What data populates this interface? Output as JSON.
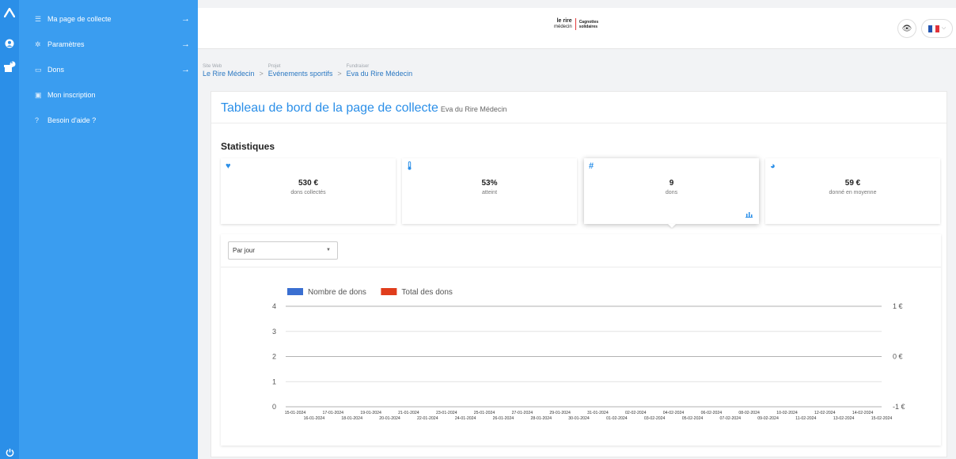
{
  "colors": {
    "accent": "#2b8fe8",
    "menu_bg": "#3a9df0",
    "series_count": "#3a6fd1",
    "series_total": "#e03d1c"
  },
  "rail": {
    "icons": [
      "logo-icon",
      "user-icon",
      "gift-icon",
      "power-icon"
    ],
    "badge": "1"
  },
  "menu": {
    "items": [
      {
        "label": "Ma page de collecte",
        "icon": "list-icon",
        "arrow": "→"
      },
      {
        "label": "Paramètres",
        "icon": "gear-icon",
        "arrow": "→"
      },
      {
        "label": "Dons",
        "icon": "card-icon",
        "arrow": "→"
      },
      {
        "label": "Mon inscription",
        "icon": "ticket-icon",
        "arrow": ""
      },
      {
        "label": "Besoin d'aide ?",
        "icon": "help-icon",
        "arrow": ""
      }
    ]
  },
  "header": {
    "logo_line1": "le rire",
    "logo_line2": "médecin",
    "logo_line3": "Cagnottes",
    "logo_line4": "solidaires"
  },
  "breadcrumb": [
    {
      "small": "Site Web",
      "big": "Le Rire Médecin"
    },
    {
      "small": "Projet",
      "big": "Evénements sportifs"
    },
    {
      "small": "Fundraiser",
      "big": "Eva du Rire Médecin"
    }
  ],
  "breadcrumb_sep": ">",
  "page": {
    "title": "Tableau de bord de la page de collecte",
    "subtitle": "Eva du Rire Médecin",
    "stats_heading": "Statistiques"
  },
  "stats": [
    {
      "value": "530 €",
      "label": "dons collectés",
      "icon": "heart-icon",
      "glyph": "♥"
    },
    {
      "value": "53%",
      "label": "atteint",
      "icon": "thermometer-icon",
      "glyph": "🌡"
    },
    {
      "value": "9",
      "label": "dons",
      "icon": "hash-icon",
      "glyph": "#"
    },
    {
      "value": "59 €",
      "label": "donné en moyenne",
      "icon": "gauge-icon",
      "glyph": "◕"
    }
  ],
  "filter": {
    "selected": "Par jour"
  },
  "chart_data": {
    "type": "line",
    "series": [
      {
        "name": "Nombre de dons",
        "values": []
      },
      {
        "name": "Total des dons",
        "values": []
      }
    ],
    "ylim_left": [
      0,
      4
    ],
    "yticks_left": [
      "0",
      "1",
      "2",
      "3",
      "4"
    ],
    "yticks_right": [
      "-1 €",
      "0 €",
      "1 €"
    ],
    "x": [
      "15-01-2024",
      "16-01-2024",
      "17-01-2024",
      "18-01-2024",
      "19-01-2024",
      "20-01-2024",
      "21-01-2024",
      "22-01-2024",
      "23-01-2024",
      "24-01-2024",
      "25-01-2024",
      "26-01-2024",
      "27-01-2024",
      "28-01-2024",
      "29-01-2024",
      "30-01-2024",
      "31-01-2024",
      "01-02-2024",
      "02-02-2024",
      "03-02-2024",
      "04-02-2024",
      "05-02-2024",
      "06-02-2024",
      "07-02-2024",
      "08-02-2024",
      "09-02-2024",
      "10-02-2024",
      "11-02-2024",
      "12-02-2024",
      "13-02-2024",
      "14-02-2024",
      "15-02-2024"
    ],
    "legend": "top-left",
    "grid": true
  }
}
